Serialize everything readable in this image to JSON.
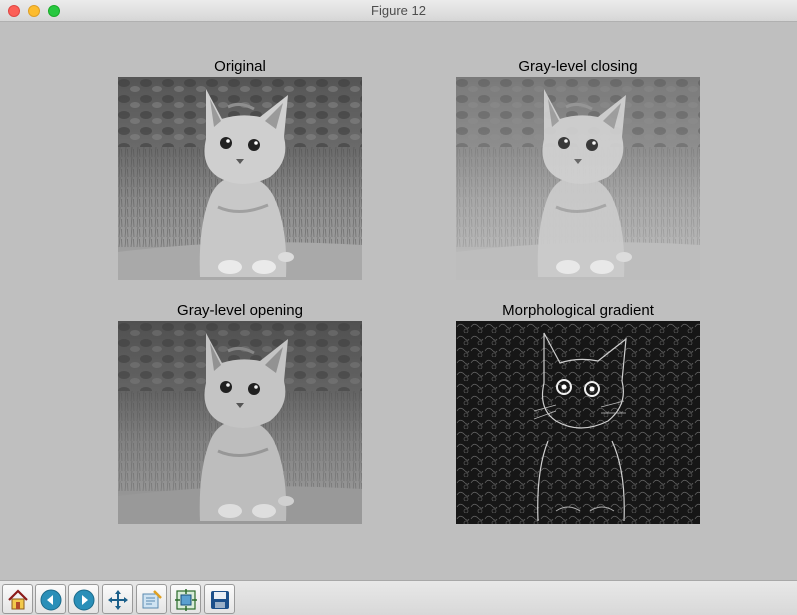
{
  "window": {
    "title": "Figure 12"
  },
  "subplots": [
    {
      "title": "Original",
      "image": "grayscale kitten photo"
    },
    {
      "title": "Gray-level closing",
      "image": "grayscale kitten photo, closed"
    },
    {
      "title": "Gray-level opening",
      "image": "grayscale kitten photo, opened"
    },
    {
      "title": "Morphological gradient",
      "image": "edge map of kitten photo"
    }
  ],
  "toolbar": {
    "buttons": [
      {
        "icon": "home-icon"
      },
      {
        "icon": "back-icon"
      },
      {
        "icon": "forward-icon"
      },
      {
        "icon": "pan-icon"
      },
      {
        "icon": "zoom-icon"
      },
      {
        "icon": "configure-subplots-icon"
      },
      {
        "icon": "save-icon"
      }
    ]
  }
}
